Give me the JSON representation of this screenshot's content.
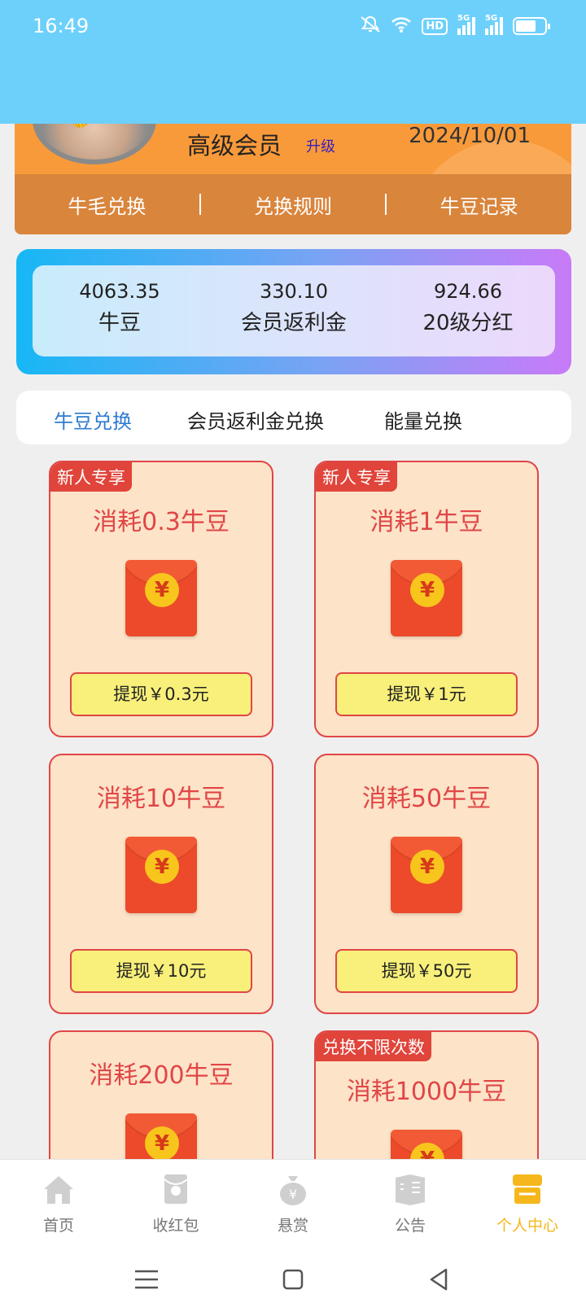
{
  "status_bar": {
    "time": "16:49",
    "hd_label": "HD",
    "net_label": "5G"
  },
  "member": {
    "level": "高级会员",
    "upgrade": "升级",
    "date": "2024/10/01",
    "nav": [
      "牛毛兑换",
      "兑换规则",
      "牛豆记录"
    ]
  },
  "stats": [
    {
      "value": "4063.35",
      "label": "牛豆"
    },
    {
      "value": "330.10",
      "label": "会员返利金"
    },
    {
      "value": "924.66",
      "label": "20级分红"
    }
  ],
  "tabs": [
    "牛豆兑换",
    "会员返利金兑换",
    "能量兑换"
  ],
  "cards": [
    {
      "tag": "新人专享",
      "title": "消耗0.3牛豆",
      "button": "提现￥0.3元"
    },
    {
      "tag": "新人专享",
      "title": "消耗1牛豆",
      "button": "提现￥1元"
    },
    {
      "tag": "",
      "title": "消耗10牛豆",
      "button": "提现￥10元"
    },
    {
      "tag": "",
      "title": "消耗50牛豆",
      "button": "提现￥50元"
    },
    {
      "tag": "",
      "title": "消耗200牛豆",
      "button": ""
    },
    {
      "tag": "兑换不限次数",
      "title": "消耗1000牛豆",
      "button": ""
    }
  ],
  "coin_symbol": "¥",
  "bottom_nav": [
    {
      "label": "首页",
      "icon": "home-icon"
    },
    {
      "label": "收红包",
      "icon": "red-envelope-icon"
    },
    {
      "label": "悬赏",
      "icon": "money-bag-icon"
    },
    {
      "label": "公告",
      "icon": "announcement-icon"
    },
    {
      "label": "个人中心",
      "icon": "personal-center-icon",
      "active": true
    }
  ],
  "colors": {
    "header": "#6dd0fb",
    "accent_red": "#e04646",
    "active_nav": "#f5b71c",
    "tab_active": "#2f7bd0"
  }
}
